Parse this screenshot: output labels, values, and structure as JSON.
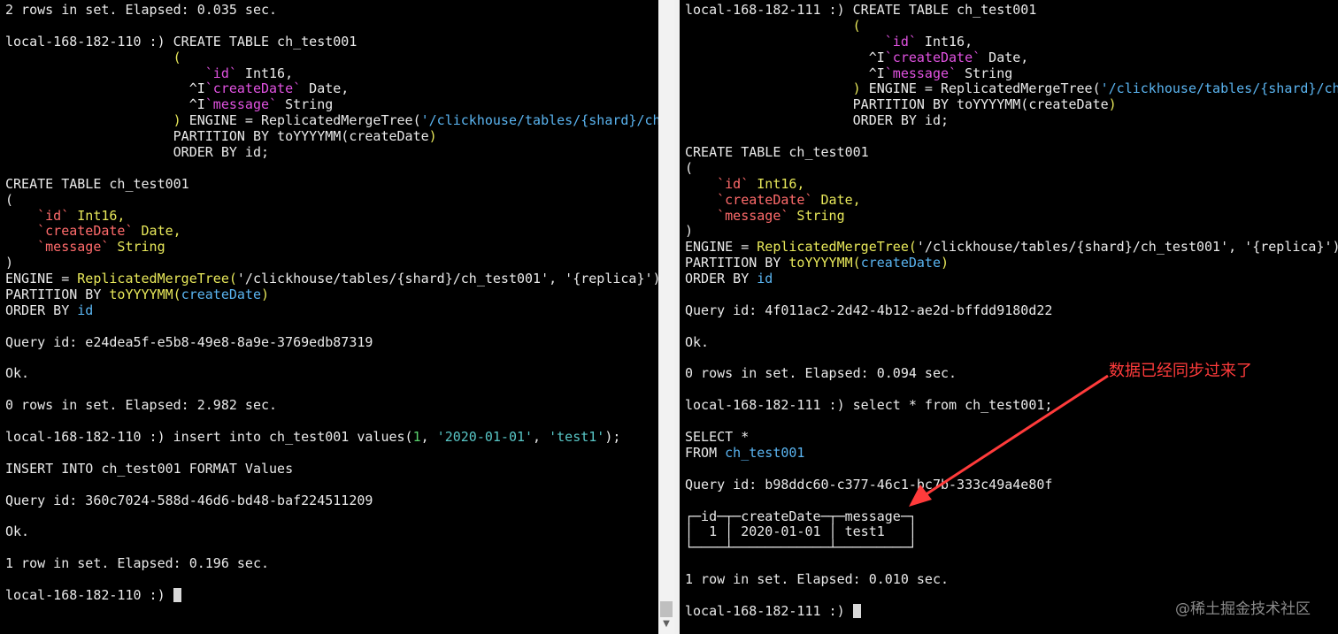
{
  "left_terminal": {
    "lines": [
      [
        {
          "t": "2 rows in set. Elapsed: 0.035 sec.",
          "c": "white"
        }
      ],
      [],
      [
        {
          "t": "local-168-182-110 :) CREATE TABLE ch_test001",
          "c": "white"
        }
      ],
      [
        {
          "t": "                     (",
          "c": "yellow"
        }
      ],
      [
        {
          "t": "                         ",
          "c": "white"
        },
        {
          "t": "`id`",
          "c": "magenta"
        },
        {
          "t": " Int16,",
          "c": "white"
        }
      ],
      [
        {
          "t": "                       ^I",
          "c": "white"
        },
        {
          "t": "`createDate`",
          "c": "magenta"
        },
        {
          "t": " Date,",
          "c": "white"
        }
      ],
      [
        {
          "t": "                       ^I",
          "c": "white"
        },
        {
          "t": "`message`",
          "c": "magenta"
        },
        {
          "t": " String",
          "c": "white"
        }
      ],
      [
        {
          "t": "                     )",
          "c": "yellow"
        },
        {
          "t": " ENGINE = ReplicatedMergeTree(",
          "c": "white"
        },
        {
          "t": "'/clickhouse/tables/{shard}/ch",
          "c": "blue"
        }
      ],
      [
        {
          "t": "                     PARTITION BY toYYYYMM(",
          "c": "white"
        },
        {
          "t": "createDate",
          "c": "white"
        },
        {
          "t": ")",
          "c": "yellow"
        }
      ],
      [
        {
          "t": "                     ORDER BY id;",
          "c": "white"
        }
      ],
      [],
      [
        {
          "t": "CREATE TABLE ch_test001",
          "c": "white"
        }
      ],
      [
        {
          "t": "(",
          "c": "white"
        }
      ],
      [
        {
          "t": "    ",
          "c": "white"
        },
        {
          "t": "`id`",
          "c": "red"
        },
        {
          "t": " Int16,",
          "c": "yellow"
        }
      ],
      [
        {
          "t": "    ",
          "c": "white"
        },
        {
          "t": "`createDate`",
          "c": "red"
        },
        {
          "t": " Date,",
          "c": "yellow"
        }
      ],
      [
        {
          "t": "    ",
          "c": "white"
        },
        {
          "t": "`message`",
          "c": "red"
        },
        {
          "t": " String",
          "c": "yellow"
        }
      ],
      [
        {
          "t": ")",
          "c": "white"
        }
      ],
      [
        {
          "t": "ENGINE = ",
          "c": "white"
        },
        {
          "t": "ReplicatedMergeTree(",
          "c": "yellow"
        },
        {
          "t": "'/clickhouse/tables/{shard}/ch_test001', '{replica}')",
          "c": "white"
        }
      ],
      [
        {
          "t": "PARTITION BY ",
          "c": "white"
        },
        {
          "t": "toYYYYMM(",
          "c": "yellow"
        },
        {
          "t": "createDate",
          "c": "blue"
        },
        {
          "t": ")",
          "c": "yellow"
        }
      ],
      [
        {
          "t": "ORDER BY ",
          "c": "white"
        },
        {
          "t": "id",
          "c": "blue"
        }
      ],
      [],
      [
        {
          "t": "Query id: e24dea5f-e5b8-49e8-8a9e-3769edb87319",
          "c": "white"
        }
      ],
      [],
      [
        {
          "t": "Ok.",
          "c": "white"
        }
      ],
      [],
      [
        {
          "t": "0 rows in set. Elapsed: 2.982 sec.",
          "c": "white"
        }
      ],
      [],
      [
        {
          "t": "local-168-182-110 :) insert into ch_test001 values(",
          "c": "white"
        },
        {
          "t": "1",
          "c": "green"
        },
        {
          "t": ", ",
          "c": "white"
        },
        {
          "t": "'2020-01-01'",
          "c": "cyan"
        },
        {
          "t": ", ",
          "c": "white"
        },
        {
          "t": "'test1'",
          "c": "cyan"
        },
        {
          "t": ");",
          "c": "white"
        }
      ],
      [],
      [
        {
          "t": "INSERT INTO ch_test001 FORMAT Values",
          "c": "white"
        }
      ],
      [],
      [
        {
          "t": "Query id: 360c7024-588d-46d6-bd48-baf224511209",
          "c": "white"
        }
      ],
      [],
      [
        {
          "t": "Ok.",
          "c": "white"
        }
      ],
      [],
      [
        {
          "t": "1 row in set. Elapsed: 0.196 sec.",
          "c": "white"
        }
      ],
      [],
      [
        {
          "t": "local-168-182-110 :) ",
          "c": "white"
        },
        {
          "cursor": true
        }
      ]
    ]
  },
  "right_terminal": {
    "lines": [
      [
        {
          "t": "local-168-182-111 :) CREATE TABLE ch_test001",
          "c": "white"
        }
      ],
      [
        {
          "t": "                     (",
          "c": "yellow"
        }
      ],
      [
        {
          "t": "                         ",
          "c": "white"
        },
        {
          "t": "`id`",
          "c": "magenta"
        },
        {
          "t": " Int16,",
          "c": "white"
        }
      ],
      [
        {
          "t": "                       ^I",
          "c": "white"
        },
        {
          "t": "`createDate`",
          "c": "magenta"
        },
        {
          "t": " Date,",
          "c": "white"
        }
      ],
      [
        {
          "t": "                       ^I",
          "c": "white"
        },
        {
          "t": "`message`",
          "c": "magenta"
        },
        {
          "t": " String",
          "c": "white"
        }
      ],
      [
        {
          "t": "                     )",
          "c": "yellow"
        },
        {
          "t": " ENGINE = ReplicatedMergeTree(",
          "c": "white"
        },
        {
          "t": "'/clickhouse/tables/{shard}/ch",
          "c": "blue"
        }
      ],
      [
        {
          "t": "                     PARTITION BY toYYYYMM(",
          "c": "white"
        },
        {
          "t": "createDate",
          "c": "white"
        },
        {
          "t": ")",
          "c": "yellow"
        }
      ],
      [
        {
          "t": "                     ORDER BY id;",
          "c": "white"
        }
      ],
      [],
      [
        {
          "t": "CREATE TABLE ch_test001",
          "c": "white"
        }
      ],
      [
        {
          "t": "(",
          "c": "white"
        }
      ],
      [
        {
          "t": "    ",
          "c": "white"
        },
        {
          "t": "`id`",
          "c": "red"
        },
        {
          "t": " Int16,",
          "c": "yellow"
        }
      ],
      [
        {
          "t": "    ",
          "c": "white"
        },
        {
          "t": "`createDate`",
          "c": "red"
        },
        {
          "t": " Date,",
          "c": "yellow"
        }
      ],
      [
        {
          "t": "    ",
          "c": "white"
        },
        {
          "t": "`message`",
          "c": "red"
        },
        {
          "t": " String",
          "c": "yellow"
        }
      ],
      [
        {
          "t": ")",
          "c": "white"
        }
      ],
      [
        {
          "t": "ENGINE = ",
          "c": "white"
        },
        {
          "t": "ReplicatedMergeTree(",
          "c": "yellow"
        },
        {
          "t": "'/clickhouse/tables/{shard}/ch_test001', '{replica}')",
          "c": "white"
        }
      ],
      [
        {
          "t": "PARTITION BY ",
          "c": "white"
        },
        {
          "t": "toYYYYMM(",
          "c": "yellow"
        },
        {
          "t": "createDate",
          "c": "blue"
        },
        {
          "t": ")",
          "c": "yellow"
        }
      ],
      [
        {
          "t": "ORDER BY ",
          "c": "white"
        },
        {
          "t": "id",
          "c": "blue"
        }
      ],
      [],
      [
        {
          "t": "Query id: 4f011ac2-2d42-4b12-ae2d-bffdd9180d22",
          "c": "white"
        }
      ],
      [],
      [
        {
          "t": "Ok.",
          "c": "white"
        }
      ],
      [],
      [
        {
          "t": "0 rows in set. Elapsed: 0.094 sec.",
          "c": "white"
        }
      ],
      [],
      [
        {
          "t": "local-168-182-111 :) select * from ch_test001;",
          "c": "white"
        }
      ],
      [],
      [
        {
          "t": "SELECT *",
          "c": "white"
        }
      ],
      [
        {
          "t": "FROM ",
          "c": "white"
        },
        {
          "t": "ch_test001",
          "c": "blue"
        }
      ],
      [],
      [
        {
          "t": "Query id: b98ddc60-c377-46c1-bc7b-333c49a4e80f",
          "c": "white"
        }
      ],
      [],
      [
        {
          "t": "┌─id─┬─createDate─┬─message─┐",
          "c": "white"
        }
      ],
      [
        {
          "t": "│  1 │ 2020-01-01 │ test1   │",
          "c": "white"
        }
      ],
      [
        {
          "t": "└────┴────────────┴─────────┘",
          "c": "white"
        }
      ],
      [],
      [
        {
          "t": "1 row in set. Elapsed: 0.010 sec.",
          "c": "white"
        }
      ],
      [],
      [
        {
          "t": "local-168-182-111 :) ",
          "c": "white"
        },
        {
          "cursor": true
        }
      ]
    ]
  },
  "annotation": {
    "text": "数据已经同步过来了",
    "color": "#ff3b3b"
  },
  "watermark": {
    "text": "@稀土掘金技术社区"
  },
  "colors": {
    "white": "#eaeaea",
    "yellow": "#e8e85a",
    "blue": "#5ab4f0",
    "magenta": "#e052e0",
    "red": "#ff6b6b",
    "green": "#5ad26e",
    "cyan": "#58c6c6"
  }
}
